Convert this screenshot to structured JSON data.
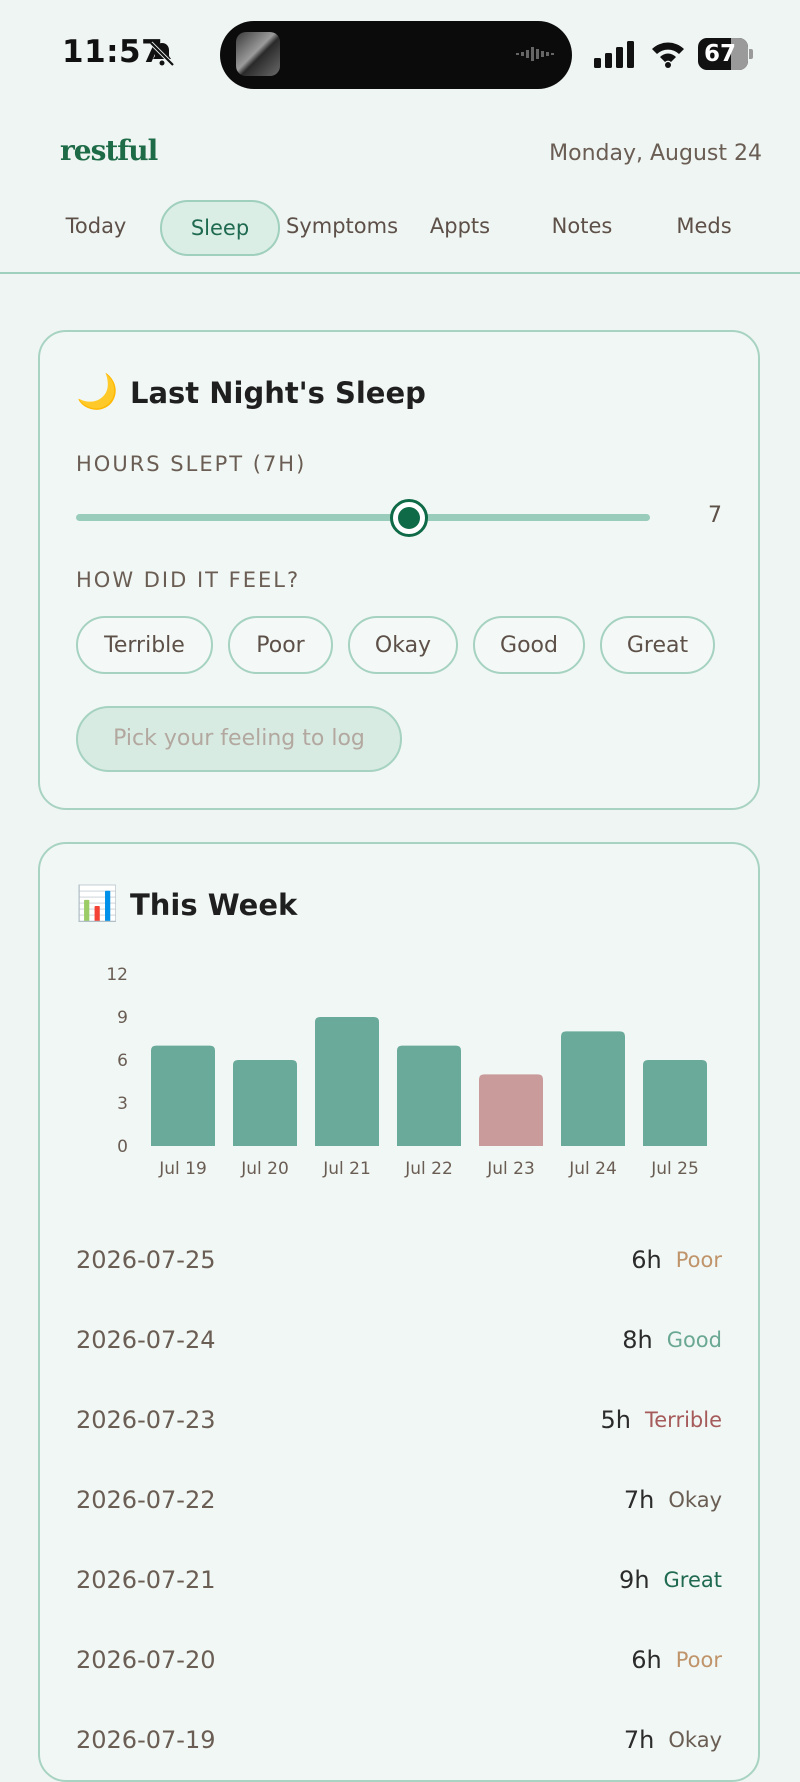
{
  "status_bar": {
    "time": "11:57",
    "battery": "67"
  },
  "header": {
    "brand": "restful",
    "date": "Monday, August 24"
  },
  "tabs": [
    {
      "label": "Today"
    },
    {
      "label": "Sleep",
      "active": true
    },
    {
      "label": "Symptoms"
    },
    {
      "label": "Appts"
    },
    {
      "label": "Notes"
    },
    {
      "label": "Meds"
    }
  ],
  "last_night": {
    "emoji": "🌙",
    "title": "Last Night's Sleep",
    "hours_label": "HOURS SLEPT (7H)",
    "hours_value": "7",
    "slider_fraction": 0.58,
    "feel_label": "HOW DID IT FEEL?",
    "feelings": [
      "Terrible",
      "Poor",
      "Okay",
      "Good",
      "Great"
    ],
    "log_button": "Pick your feeling to log"
  },
  "week": {
    "emoji": "📊",
    "title": "This Week"
  },
  "chart_data": {
    "type": "bar",
    "categories": [
      "Jul 19",
      "Jul 20",
      "Jul 21",
      "Jul 22",
      "Jul 23",
      "Jul 24",
      "Jul 25"
    ],
    "values": [
      7,
      6,
      9,
      7,
      5,
      8,
      6
    ],
    "ylim": [
      0,
      12
    ],
    "yticks": [
      "0",
      "3",
      "6",
      "9",
      "12"
    ],
    "bar_colors": [
      "#69aa9a",
      "#69aa9a",
      "#69aa9a",
      "#69aa9a",
      "#c99b9a",
      "#69aa9a",
      "#69aa9a"
    ],
    "grid": false
  },
  "log": [
    {
      "date": "2026-07-25",
      "hours": "6h",
      "feeling": "Poor",
      "color": "#c0946b"
    },
    {
      "date": "2026-07-24",
      "hours": "8h",
      "feeling": "Good",
      "color": "#6aa894"
    },
    {
      "date": "2026-07-23",
      "hours": "5h",
      "feeling": "Terrible",
      "color": "#a65b5b"
    },
    {
      "date": "2026-07-22",
      "hours": "7h",
      "feeling": "Okay",
      "color": "#6a5d54"
    },
    {
      "date": "2026-07-21",
      "hours": "9h",
      "feeling": "Great",
      "color": "#1f6a50"
    },
    {
      "date": "2026-07-20",
      "hours": "6h",
      "feeling": "Poor",
      "color": "#c0946b"
    },
    {
      "date": "2026-07-19",
      "hours": "7h",
      "feeling": "Okay",
      "color": "#6a5d54"
    }
  ]
}
